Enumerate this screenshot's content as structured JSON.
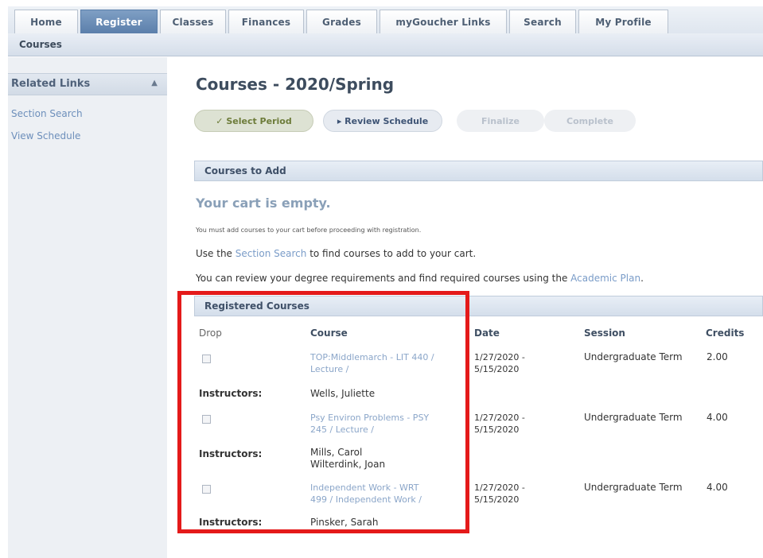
{
  "tabs": [
    "Home",
    "Register",
    "Classes",
    "Finances",
    "Grades",
    "myGoucher Links",
    "Search",
    "My Profile"
  ],
  "subnav": {
    "item": "Courses"
  },
  "sidebar": {
    "heading": "Related Links",
    "caret": "▲",
    "links": [
      "Section Search",
      "View Schedule"
    ]
  },
  "main": {
    "title": "Courses - 2020/Spring",
    "steps": {
      "select": "✓ Select Period",
      "review": "▸ Review Schedule",
      "finalize": "Finalize",
      "complete": "Complete"
    },
    "courses_to_add": "Courses to Add",
    "cart_empty": "Your cart is empty.",
    "cart_note": "You must add courses to your cart before proceeding with registration.",
    "line1": {
      "pre": "Use the ",
      "link": "Section Search",
      "post": " to find courses to add to your cart."
    },
    "line2": {
      "pre": "You can review your degree requirements and find required courses using the ",
      "link": "Academic Plan",
      "post": "."
    },
    "registered": {
      "heading": "Registered Courses",
      "columns": {
        "drop": "Drop",
        "course": "Course",
        "date": "Date",
        "session": "Session",
        "credits": "Credits"
      },
      "instructors_label": "Instructors:",
      "rows": [
        {
          "course1": "TOP:Middlemarch - LIT 440 /",
          "course2": "Lecture /",
          "date1": "1/27/2020 -",
          "date2": "5/15/2020",
          "session": "Undergraduate Term",
          "credits": "2.00",
          "instr1": "Wells, Juliette",
          "instr2": ""
        },
        {
          "course1": "Psy Environ Problems - PSY",
          "course2": "245 / Lecture /",
          "date1": "1/27/2020 -",
          "date2": "5/15/2020",
          "session": "Undergraduate Term",
          "credits": "4.00",
          "instr1": "Mills, Carol",
          "instr2": "Wilterdink, Joan"
        },
        {
          "course1": "Independent Work - WRT",
          "course2": "499 / Independent Work /",
          "date1": "1/27/2020 -",
          "date2": "5/15/2020",
          "session": "Undergraduate Term",
          "credits": "4.00",
          "instr1": "Pinsker, Sarah",
          "instr2": ""
        }
      ]
    }
  },
  "colors": {
    "highlight": "#e41a1a",
    "active_tab": "#5b7fab",
    "link": "#7a9cc8"
  }
}
